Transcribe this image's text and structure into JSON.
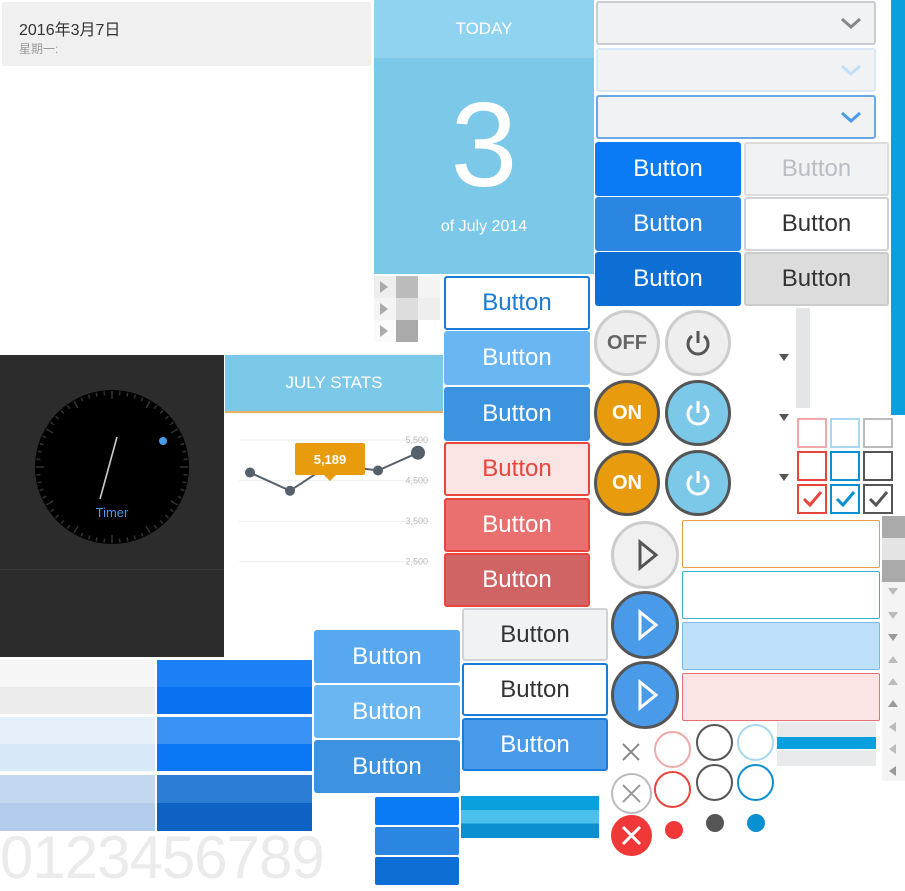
{
  "date_widget": {
    "date": "2016年3月7日",
    "weekday": "星期一:"
  },
  "today_card": {
    "header": "TODAY",
    "day": "3",
    "caption": "of July 2014"
  },
  "timer": {
    "label": "Timer"
  },
  "stats": {
    "title": "JULY STATS",
    "tooltip": "5,189",
    "ticks": [
      "5,500",
      "4,500",
      "3,500",
      "2,500"
    ]
  },
  "chart_data": {
    "type": "line",
    "title": "JULY STATS",
    "x": [
      1,
      2,
      3,
      4,
      5
    ],
    "values": [
      4700,
      4250,
      4900,
      4750,
      5189
    ],
    "yticks": [
      5500,
      4500,
      3500,
      2500
    ],
    "ylim": [
      2000,
      5700
    ]
  },
  "buttons": {
    "label": "Button",
    "right_col": [
      {
        "label": "Button",
        "bg": "#0a7af5",
        "color": "#ffffff"
      },
      {
        "label": "Button",
        "bg": "#2a86e0",
        "color": "#ffffff"
      },
      {
        "label": "Button",
        "bg": "#0d6fd6",
        "color": "#ffffff"
      }
    ],
    "right_col2": [
      {
        "label": "Button",
        "bg": "#f0f2f4",
        "color": "#b8bec4"
      },
      {
        "label": "Button",
        "bg": "#ffffff",
        "color": "#333333"
      },
      {
        "label": "Button",
        "bg": "#dcdcdc",
        "color": "#333333"
      }
    ],
    "mid_col": [
      {
        "label": "Button",
        "bg": "#ffffff",
        "color": "#1a7bd8"
      },
      {
        "label": "Button",
        "bg": "#6ab6f2",
        "color": "#ffffff"
      },
      {
        "label": "Button",
        "bg": "#3c93df",
        "color": "#ffffff"
      },
      {
        "label": "Button",
        "bg": "#fbe4e4",
        "color": "#e8453c"
      },
      {
        "label": "Button",
        "bg": "#ea7070",
        "color": "#ffffff"
      },
      {
        "label": "Button",
        "bg": "#d06464",
        "color": "#ffffff"
      }
    ],
    "lower_col": [
      {
        "label": "Button",
        "bg": "#f0f2f4",
        "color": "#333333"
      },
      {
        "label": "Button",
        "bg": "#ffffff",
        "color": "#333333"
      },
      {
        "label": "Button",
        "bg": "#4a9aea",
        "color": "#ffffff"
      }
    ],
    "left_col": [
      {
        "label": "Button",
        "bg": "#58a8f0",
        "color": "#ffffff"
      },
      {
        "label": "Button",
        "bg": "#6ab6f2",
        "color": "#ffffff"
      },
      {
        "label": "Button",
        "bg": "#3d93df",
        "color": "#ffffff"
      }
    ]
  },
  "toggles": {
    "off": "OFF",
    "on": "ON"
  },
  "digits": "0123456789",
  "colors": {
    "accent": "#0a7af5",
    "sky": "#7cc8e8",
    "orange": "#e89b0c",
    "red": "#e8453c"
  }
}
